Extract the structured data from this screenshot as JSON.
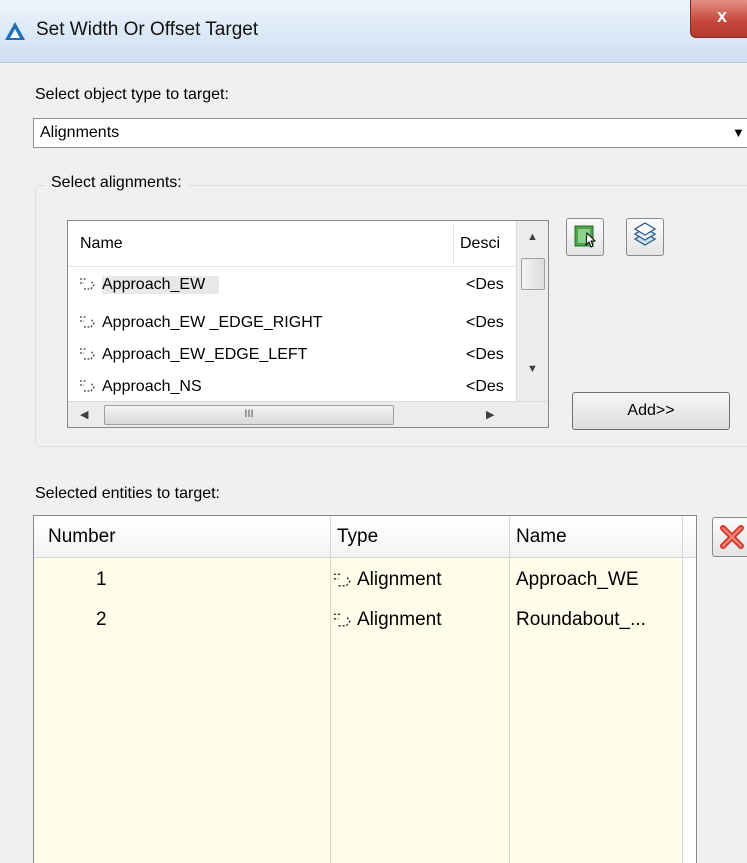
{
  "window": {
    "title": "Set Width Or Offset Target",
    "close_label": "x"
  },
  "object_type": {
    "label": "Select object type to target:",
    "selected": "Alignments"
  },
  "alignments_group": {
    "title": "Select alignments:",
    "columns": [
      "Name",
      "Desci"
    ],
    "rows": [
      {
        "name": "Approach_EW",
        "desc": "<Des"
      },
      {
        "name": "Approach_EW _EDGE_RIGHT",
        "desc": "<Des"
      },
      {
        "name": "Approach_EW_EDGE_LEFT",
        "desc": "<Des"
      },
      {
        "name": "Approach_NS",
        "desc": "<Des"
      }
    ],
    "hscroll_grip": "III",
    "add_label": "Add>>"
  },
  "selected_entities": {
    "label": "Selected entities to target:",
    "columns": [
      "Number",
      "Type",
      "Name"
    ],
    "rows": [
      {
        "number": "1",
        "type": "Alignment",
        "name": "Approach_WE"
      },
      {
        "number": "2",
        "type": "Alignment",
        "name": "Roundabout_..."
      }
    ]
  },
  "colors": {
    "list_bg": "#fffdea",
    "titlebar": "#dbe8f6",
    "close": "#c7473a"
  }
}
